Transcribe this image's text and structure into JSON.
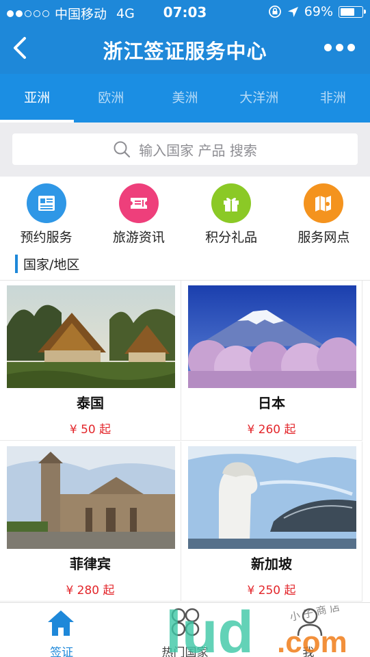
{
  "status_bar": {
    "carrier": "中国移动",
    "network": "4G",
    "time": "07:03",
    "battery": "69%",
    "battery_level": 0.69
  },
  "header": {
    "title": "浙江签证服务中心"
  },
  "tabs": [
    {
      "label": "亚洲",
      "active": true
    },
    {
      "label": "欧洲"
    },
    {
      "label": "美洲"
    },
    {
      "label": "大洋洲"
    },
    {
      "label": "非洲"
    }
  ],
  "search": {
    "placeholder": "输入国家 产品 搜索"
  },
  "quick_links": [
    {
      "label": "预约服务",
      "icon": "document-icon",
      "color": "#2f97e6"
    },
    {
      "label": "旅游资讯",
      "icon": "ticket-icon",
      "color": "#ee3f7b"
    },
    {
      "label": "积分礼品",
      "icon": "gift-icon",
      "color": "#8bc926"
    },
    {
      "label": "服务网点",
      "icon": "map-icon",
      "color": "#f4931e"
    }
  ],
  "section": {
    "label": "国家/地区"
  },
  "countries": [
    {
      "name": "泰国",
      "price": "¥ 50 起"
    },
    {
      "name": "日本",
      "price": "¥ 260 起"
    },
    {
      "name": "菲律宾",
      "price": "¥ 280 起"
    },
    {
      "name": "新加坡",
      "price": "¥ 250 起"
    }
  ],
  "bottom_nav": [
    {
      "label": "签证",
      "icon": "home-icon",
      "active": true
    },
    {
      "label": "热门国家",
      "icon": "grid-icon"
    },
    {
      "label": "我",
      "icon": "user-icon"
    }
  ],
  "watermark": {
    "text": "lud",
    "suffix": ".com",
    "handwriting": "小 子 商 店"
  },
  "colors": {
    "primary": "#1e88d9",
    "price": "#e3262b"
  }
}
